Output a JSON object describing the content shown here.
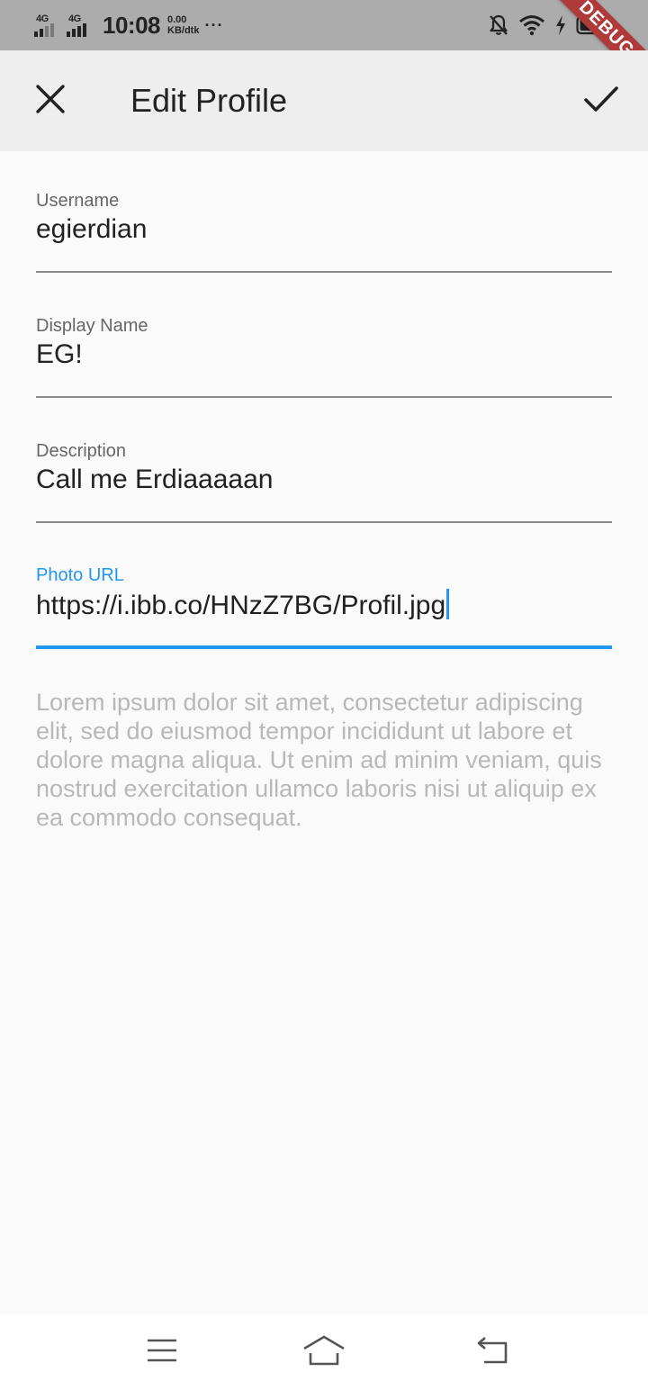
{
  "status_bar": {
    "network1": "4G",
    "network2": "4G",
    "time": "10:08",
    "speed_value": "0.00",
    "speed_unit": "KB/dtk",
    "more": "···",
    "icons": [
      "bell-off-icon",
      "wifi-icon",
      "charging-icon",
      "battery-icon"
    ]
  },
  "debug_banner": "DEBUG",
  "app_bar": {
    "close_icon": "close-icon",
    "title": "Edit Profile",
    "confirm_icon": "check-icon"
  },
  "form": {
    "fields": [
      {
        "label": "Username",
        "value": "egierdian",
        "focused": false
      },
      {
        "label": "Display Name",
        "value": "EG!",
        "focused": false
      },
      {
        "label": "Description",
        "value": "Call me Erdiaaaaan",
        "focused": false
      },
      {
        "label": "Photo URL",
        "value": "https://i.ibb.co/HNzZ7BG/Profil.jpg",
        "focused": true
      }
    ],
    "hint": "Lorem ipsum dolor sit amet, consectetur adipiscing elit, sed do eiusmod tempor incididunt ut labore et dolore magna aliqua. Ut enim ad minim veniam, quis nostrud exercitation ullamco laboris nisi ut aliquip ex ea commodo consequat."
  },
  "nav_bar": {
    "icons": [
      "menu-icon",
      "home-icon",
      "back-icon"
    ]
  },
  "colors": {
    "accent": "#2196f3",
    "status_bar_bg": "#acacac",
    "app_bar_bg": "#eeeeee",
    "page_bg": "#fafafa",
    "debug_ribbon": "#b03a3a"
  }
}
